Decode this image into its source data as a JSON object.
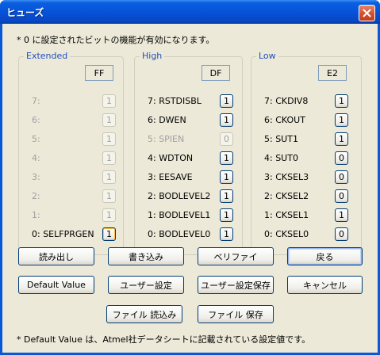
{
  "window": {
    "title": "ヒューズ"
  },
  "top_note": "* 0 に設定されたビットの機能が有効になります。",
  "bottom_note": "* Default Value は、Atmel社データシートに記載されている設定値です。",
  "groups": {
    "extended": {
      "label": "Extended",
      "hex": "FF",
      "rows": [
        {
          "label": "7:",
          "value": "1"
        },
        {
          "label": "6:",
          "value": "1"
        },
        {
          "label": "5:",
          "value": "1"
        },
        {
          "label": "4:",
          "value": "1"
        },
        {
          "label": "3:",
          "value": "1"
        },
        {
          "label": "2:",
          "value": "1"
        },
        {
          "label": "1:",
          "value": "1"
        },
        {
          "label": "0: SELFPRGEN",
          "value": "1"
        }
      ]
    },
    "high": {
      "label": "High",
      "hex": "DF",
      "rows": [
        {
          "label": "7: RSTDISBL",
          "value": "1"
        },
        {
          "label": "6: DWEN",
          "value": "1"
        },
        {
          "label": "5: SPIEN",
          "value": "0"
        },
        {
          "label": "4: WDTON",
          "value": "1"
        },
        {
          "label": "3: EESAVE",
          "value": "1"
        },
        {
          "label": "2: BODLEVEL2",
          "value": "1"
        },
        {
          "label": "1: BODLEVEL1",
          "value": "1"
        },
        {
          "label": "0: BODLEVEL0",
          "value": "1"
        }
      ]
    },
    "low": {
      "label": "Low",
      "hex": "E2",
      "rows": [
        {
          "label": "7: CKDIV8",
          "value": "1"
        },
        {
          "label": "6: CKOUT",
          "value": "1"
        },
        {
          "label": "5: SUT1",
          "value": "1"
        },
        {
          "label": "4: SUT0",
          "value": "0"
        },
        {
          "label": "3: CKSEL3",
          "value": "0"
        },
        {
          "label": "2: CKSEL2",
          "value": "0"
        },
        {
          "label": "1: CKSEL1",
          "value": "1"
        },
        {
          "label": "0: CKSEL0",
          "value": "0"
        }
      ]
    }
  },
  "buttons": {
    "read": "読み出し",
    "write": "書き込み",
    "verify": "ベリファイ",
    "back": "戻る",
    "default_value": "Default Value",
    "user_setting": "ユーザー設定",
    "user_setting_save": "ユーザー設定保存",
    "cancel": "キャンセル",
    "file_load": "ファイル 読込み",
    "file_save": "ファイル 保存"
  }
}
